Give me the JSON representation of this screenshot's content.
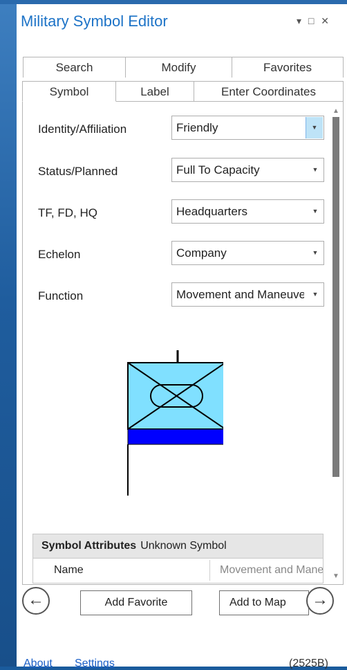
{
  "window": {
    "title": "Military Symbol Editor",
    "controls": [
      "▾",
      "□",
      "✕"
    ]
  },
  "tabs": {
    "back_row": [
      "Search",
      "Modify",
      "Favorites"
    ],
    "front_row": [
      "Symbol",
      "Label",
      "Enter Coordinates"
    ],
    "active": "Symbol"
  },
  "fields": [
    {
      "label": "Identity/Affiliation",
      "value": "Friendly"
    },
    {
      "label": "Status/Planned",
      "value": "Full To Capacity"
    },
    {
      "label": "TF, FD, HQ",
      "value": "Headquarters"
    },
    {
      "label": "Echelon",
      "value": "Company"
    },
    {
      "label": "Function",
      "value": "Movement and Maneuver"
    }
  ],
  "symbol_preview": {
    "frame_fill": "#80e0ff",
    "bar_fill": "#0000ff",
    "stroke": "#000000"
  },
  "attributes": {
    "header_bold": "Symbol Attributes",
    "header_rest": "Unknown Symbol",
    "rows": [
      {
        "name": "Name",
        "value": "Movement and Maneuver"
      }
    ]
  },
  "buttons": {
    "back_icon": "←",
    "add_favorite": "Add Favorite",
    "add_to_map": "Add to Map",
    "forward_icon": "→"
  },
  "footer": {
    "about": "About",
    "settings": "Settings",
    "code": "(2525B)"
  },
  "colors": {
    "accent": "#1d73c7",
    "link": "#1a5fc7",
    "focus_dropdown": "#bee3f7"
  }
}
